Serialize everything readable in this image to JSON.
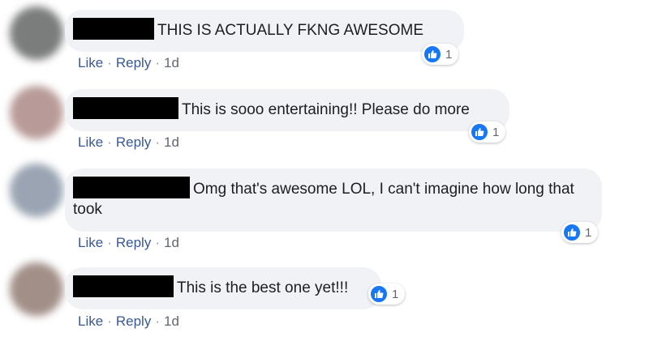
{
  "colors": {
    "like_blue": "#1877f2",
    "link_blue": "#385898",
    "bubble_gray": "#f0f2f5"
  },
  "comments": [
    {
      "avatar_color": "#7a7d7b",
      "text": "THIS IS ACTUALLY FKNG AWESOME",
      "reaction_icon": "like-thumb-icon",
      "reaction_count": "1",
      "actions": {
        "like": "Like",
        "reply": "Reply",
        "time": "1d"
      }
    },
    {
      "avatar_color": "#b89b98",
      "text": "This is sooo entertaining!! Please do more",
      "reaction_icon": "like-thumb-icon",
      "reaction_count": "1",
      "actions": {
        "like": "Like",
        "reply": "Reply",
        "time": "1d"
      }
    },
    {
      "avatar_color": "#9aa4b3",
      "text": "Omg that's awesome LOL, I can't imagine how long that took",
      "reaction_icon": "like-thumb-icon",
      "reaction_count": "1",
      "actions": {
        "like": "Like",
        "reply": "Reply",
        "time": "1d"
      }
    },
    {
      "avatar_color": "#a28f88",
      "text": "This is the best one yet!!!",
      "reaction_icon": "like-thumb-icon",
      "reaction_count": "1",
      "actions": {
        "like": "Like",
        "reply": "Reply",
        "time": "1d"
      }
    }
  ]
}
